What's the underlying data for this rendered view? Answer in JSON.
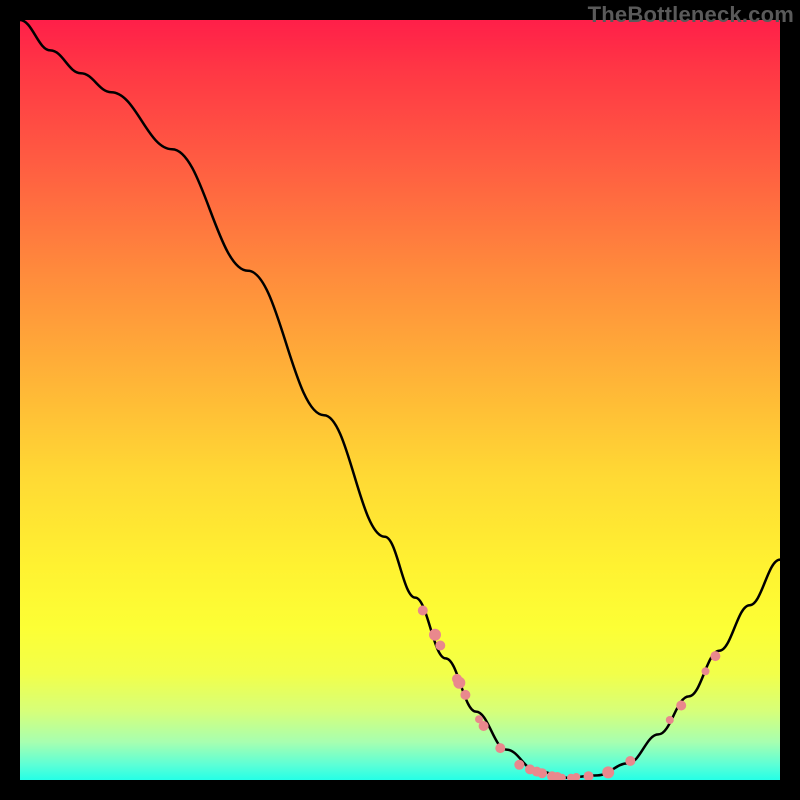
{
  "watermark": "TheBottleneck.com",
  "chart_data": {
    "type": "line",
    "title": "",
    "xlabel": "",
    "ylabel": "",
    "xlim": [
      0,
      100
    ],
    "ylim": [
      0,
      100
    ],
    "curve": [
      {
        "x": 0,
        "y": 100
      },
      {
        "x": 4,
        "y": 96
      },
      {
        "x": 8,
        "y": 93
      },
      {
        "x": 12,
        "y": 90.5
      },
      {
        "x": 20,
        "y": 83
      },
      {
        "x": 30,
        "y": 67
      },
      {
        "x": 40,
        "y": 48
      },
      {
        "x": 48,
        "y": 32
      },
      {
        "x": 52,
        "y": 24
      },
      {
        "x": 56,
        "y": 16
      },
      {
        "x": 60,
        "y": 9
      },
      {
        "x": 64,
        "y": 4
      },
      {
        "x": 68,
        "y": 1.2
      },
      {
        "x": 72,
        "y": 0.3
      },
      {
        "x": 76,
        "y": 0.6
      },
      {
        "x": 80,
        "y": 2.2
      },
      {
        "x": 84,
        "y": 6
      },
      {
        "x": 88,
        "y": 11
      },
      {
        "x": 92,
        "y": 17
      },
      {
        "x": 96,
        "y": 23
      },
      {
        "x": 100,
        "y": 29
      }
    ],
    "markers": [
      {
        "x": 53.0,
        "y": 22.3,
        "r": 5
      },
      {
        "x": 54.6,
        "y": 19.1,
        "r": 6
      },
      {
        "x": 55.3,
        "y": 17.7,
        "r": 5
      },
      {
        "x": 57.5,
        "y": 13.3,
        "r": 5
      },
      {
        "x": 57.8,
        "y": 12.8,
        "r": 6
      },
      {
        "x": 58.6,
        "y": 11.2,
        "r": 5
      },
      {
        "x": 60.4,
        "y": 8.0,
        "r": 4
      },
      {
        "x": 61.0,
        "y": 7.1,
        "r": 5
      },
      {
        "x": 63.2,
        "y": 4.2,
        "r": 5
      },
      {
        "x": 65.7,
        "y": 2.0,
        "r": 5
      },
      {
        "x": 67.1,
        "y": 1.4,
        "r": 5
      },
      {
        "x": 68.0,
        "y": 1.1,
        "r": 5
      },
      {
        "x": 68.7,
        "y": 0.9,
        "r": 5
      },
      {
        "x": 70.0,
        "y": 0.5,
        "r": 5
      },
      {
        "x": 70.7,
        "y": 0.4,
        "r": 5
      },
      {
        "x": 71.3,
        "y": 0.3,
        "r": 4
      },
      {
        "x": 72.5,
        "y": 0.3,
        "r": 4
      },
      {
        "x": 73.2,
        "y": 0.4,
        "r": 4
      },
      {
        "x": 74.8,
        "y": 0.5,
        "r": 5
      },
      {
        "x": 77.4,
        "y": 1.0,
        "r": 6
      },
      {
        "x": 80.3,
        "y": 2.5,
        "r": 5
      },
      {
        "x": 85.5,
        "y": 7.9,
        "r": 4
      },
      {
        "x": 87.0,
        "y": 9.8,
        "r": 5
      },
      {
        "x": 90.2,
        "y": 14.3,
        "r": 4
      },
      {
        "x": 91.5,
        "y": 16.3,
        "r": 5
      }
    ],
    "marker_color": "#e9888d",
    "line_color": "#000000"
  }
}
